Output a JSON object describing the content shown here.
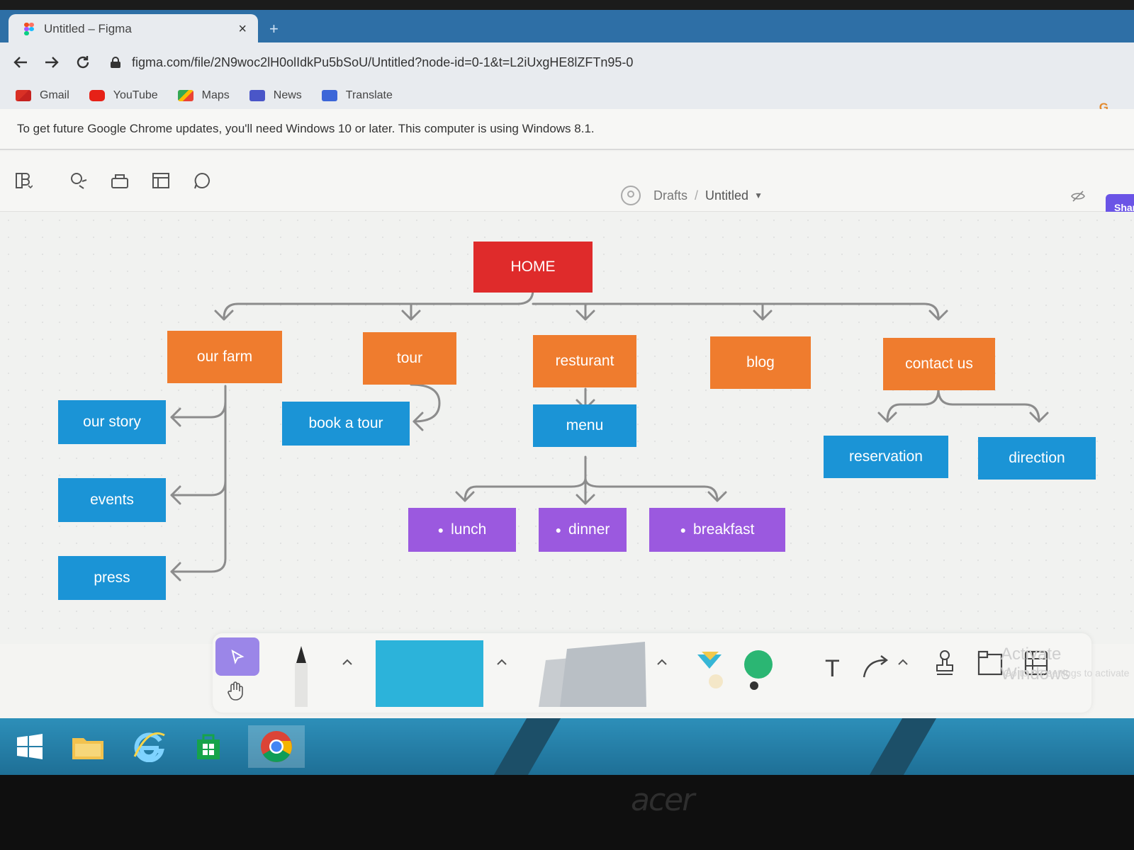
{
  "browser": {
    "tab_title": "Untitled – Figma",
    "tab_close": "×",
    "new_tab": "+",
    "url": "figma.com/file/2N9woc2lH0olIdkPu5bSoU/Untitled?node-id=0-1&t=L2iUxgHE8lZFTn95-0",
    "bookmarks": [
      "Gmail",
      "YouTube",
      "Maps",
      "News",
      "Translate"
    ],
    "profile_letter": "G",
    "infobar_text": "To get future Google Chrome updates, you'll need Windows 10 or later. This computer is using Windows 8.1."
  },
  "figma": {
    "breadcrumb_drafts": "Drafts",
    "breadcrumb_sep": "/",
    "breadcrumb_file": "Untitled",
    "share_label": "Shar"
  },
  "sitemap": {
    "home": "HOME",
    "level1": [
      "our farm",
      "tour",
      "resturant",
      "blog",
      "contact us"
    ],
    "our_farm_children": [
      "our story",
      "events",
      "press"
    ],
    "tour_child": "book a tour",
    "restaurant_child": "menu",
    "menu_children": [
      "lunch",
      "dinner",
      "breakfast"
    ],
    "contact_children": [
      "reservation",
      "direction"
    ]
  },
  "colors": {
    "home": "#df2b2b",
    "level1": "#ef7c2e",
    "level2": "#1b94d6",
    "menu_items": "#9b59df",
    "figjam_accent": "#9b86e8"
  },
  "bottom_toolbar": {
    "text_tool": "T",
    "watermark": "Activate Windows",
    "watermark_sub": "Go to PC settings to activate Windows."
  },
  "monitor": {
    "brand": "acer"
  }
}
